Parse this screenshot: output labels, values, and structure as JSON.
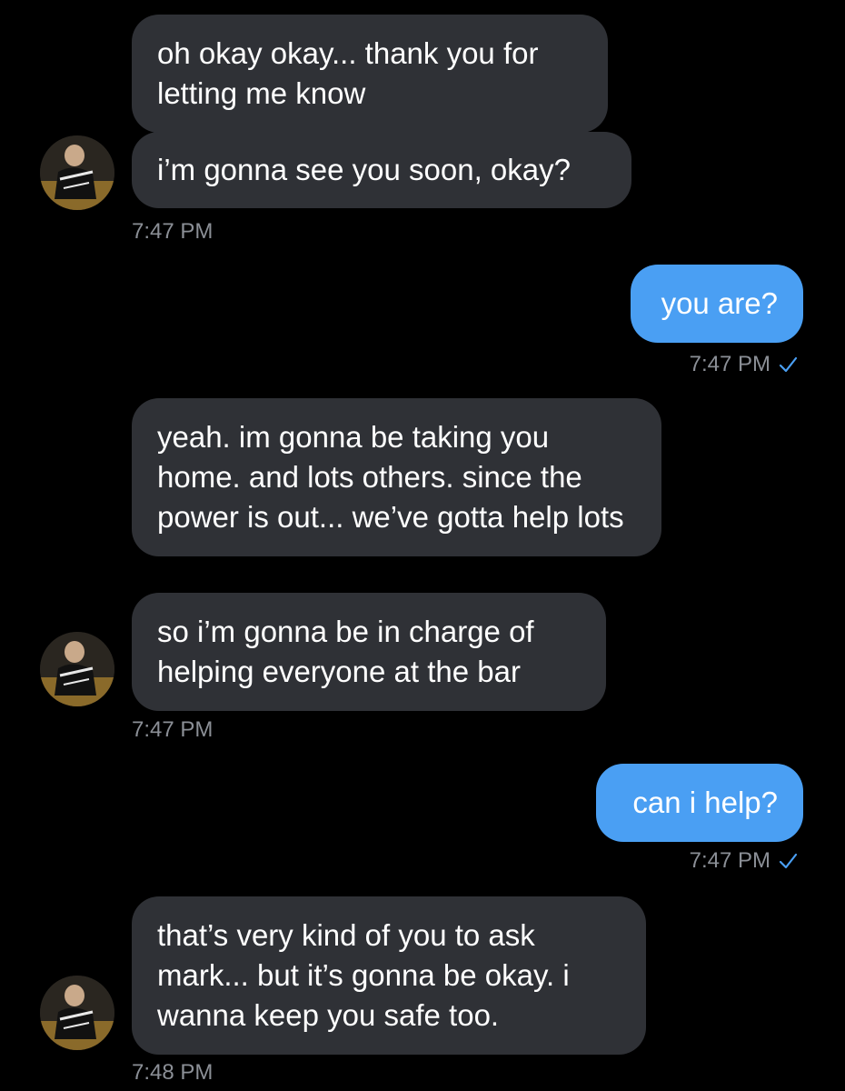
{
  "colors": {
    "background": "#000000",
    "incoming_bubble": "#2f3136",
    "outgoing_bubble": "#4a9ff3",
    "timestamp": "#8b8f96",
    "read_check": "#4a9ff3"
  },
  "messages": [
    {
      "id": "m1",
      "side": "incoming",
      "text": "oh okay okay... thank you for letting me know"
    },
    {
      "id": "m2",
      "side": "incoming",
      "text": "i’m gonna see you soon, okay?"
    },
    {
      "id": "m3",
      "side": "outgoing",
      "text": "you are?"
    },
    {
      "id": "m4",
      "side": "incoming",
      "text": "yeah. im gonna be taking you home. and lots others. since the power is out... we’ve gotta help lots"
    },
    {
      "id": "m5",
      "side": "incoming",
      "text": "so i’m gonna be in charge of helping everyone at the bar"
    },
    {
      "id": "m6",
      "side": "outgoing",
      "text": "can i help?"
    },
    {
      "id": "m7",
      "side": "incoming",
      "text": "that’s very kind of you to ask mark... but it’s gonna be okay. i wanna keep you safe too."
    }
  ],
  "timestamps": {
    "t1": "7:47 PM",
    "t2": "7:47 PM",
    "t3": "7:47 PM",
    "t4": "7:47 PM",
    "t5": "7:48 PM"
  },
  "icons": {
    "read_receipt": "checkmark-icon",
    "avatar": "contact-avatar"
  }
}
